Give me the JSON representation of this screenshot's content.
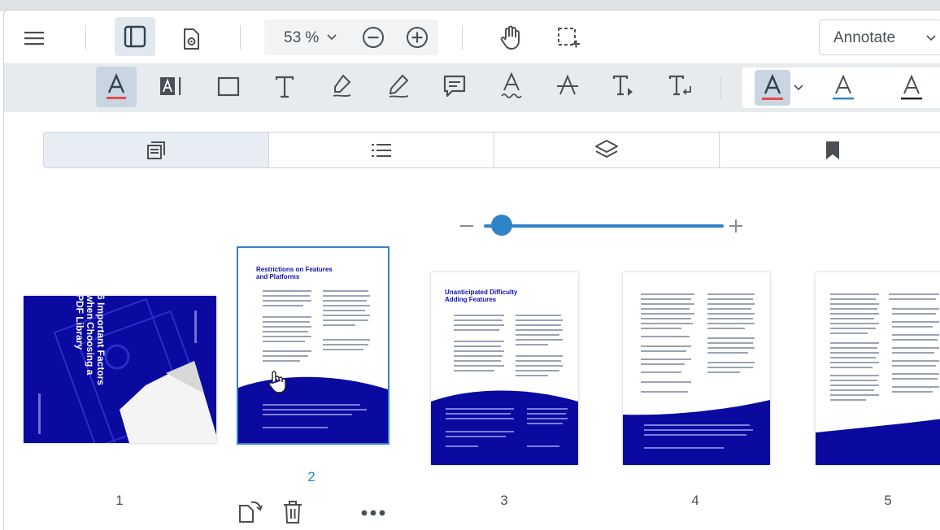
{
  "header": {
    "zoom": "53 %",
    "ribbon": "Annotate",
    "icons": [
      "menu-icon",
      "left-panel-icon",
      "settings-page-icon",
      "zoom-out-icon",
      "zoom-in-icon",
      "pan-hand-icon",
      "marquee-select-icon"
    ]
  },
  "colors": {
    "accent": "#3183c8",
    "toolbar_bg": "#e7ebee",
    "cover_blue": "#0a0aa0",
    "underline_red": "#e44d4d",
    "underline_blue": "#3183c8"
  },
  "thumbnails": [
    {
      "page": "1",
      "title_lines": [
        "6 Important Factors",
        "when Choosing a",
        "PDF Library"
      ]
    },
    {
      "page": "2",
      "title_lines": [
        "Restrictions on Features",
        "and Platforms"
      ],
      "selected": true
    },
    {
      "page": "3",
      "title_lines": [
        "Unanticipated Difficulty",
        "Adding Features"
      ]
    },
    {
      "page": "4"
    },
    {
      "page": "5"
    }
  ],
  "thumb_actions": [
    "rotate-page-icon",
    "delete-page-icon",
    "more-options-icon"
  ]
}
